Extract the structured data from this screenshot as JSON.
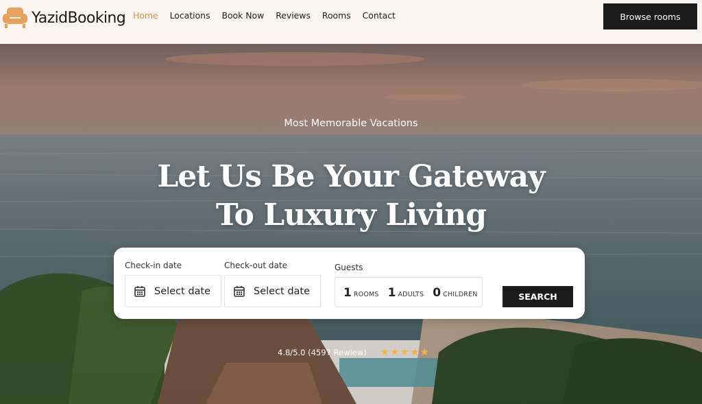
{
  "brand": {
    "name": "YazidBooking",
    "icon": "sofa-icon",
    "icon_color": "#e8a25c"
  },
  "nav": {
    "active_color": "#d4914a",
    "items": [
      {
        "label": "Home",
        "active": true
      },
      {
        "label": "Locations",
        "active": false
      },
      {
        "label": "Book Now",
        "active": false
      },
      {
        "label": "Reviews",
        "active": false
      },
      {
        "label": "Rooms",
        "active": false
      },
      {
        "label": "Contact",
        "active": false
      }
    ]
  },
  "header": {
    "cta_label": "Browse rooms"
  },
  "hero": {
    "eyebrow": "Most Memorable Vacations",
    "headline_line1": "Let Us Be Your Gateway",
    "headline_line2": "To Luxury Living"
  },
  "booking": {
    "checkin": {
      "label": "Check-in date",
      "value": "Select date",
      "icon": "calendar-icon"
    },
    "checkout": {
      "label": "Check-out date",
      "value": "Select date",
      "icon": "calendar-icon"
    },
    "guests": {
      "label": "Guests",
      "rooms": {
        "count": "1",
        "label": "ROOMS"
      },
      "adults": {
        "count": "1",
        "label": "ADULTS"
      },
      "children": {
        "count": "0",
        "label": "CHILDREN"
      }
    },
    "search_label": "SEARCH"
  },
  "rating": {
    "text": "4.8/5.0 (4597  Rewiew)",
    "stars": 5,
    "star_color": "#f3b34a"
  }
}
